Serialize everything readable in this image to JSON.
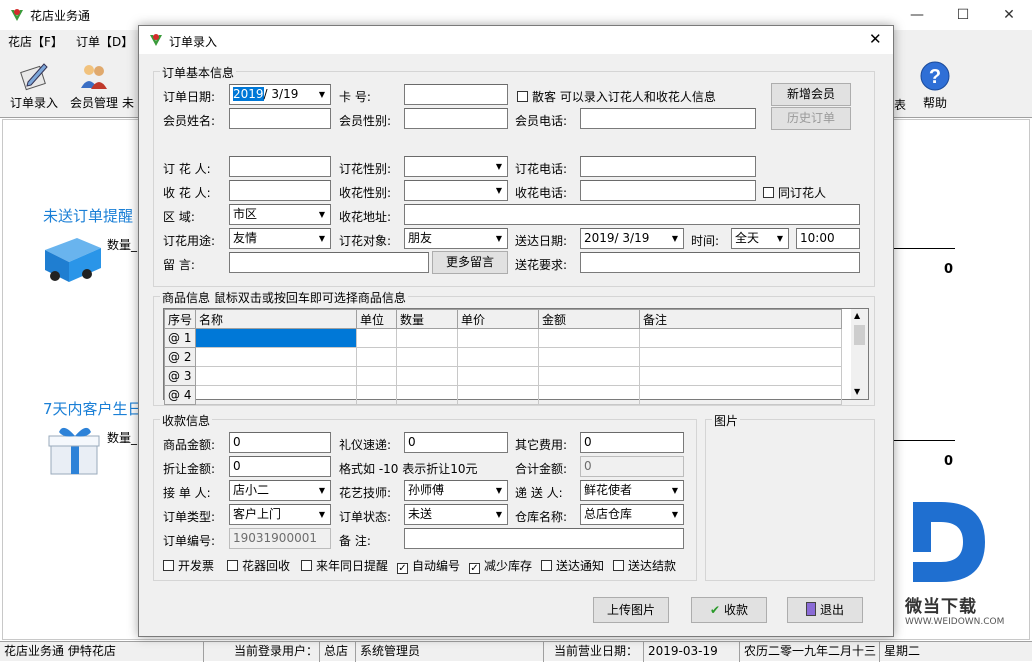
{
  "app": {
    "title": "花店业务通",
    "window_controls": {
      "minimize": "—",
      "maximize": "☐",
      "close": "✕"
    },
    "menu": [
      "花店【F】",
      "订单【D】"
    ],
    "toolbar": [
      {
        "label": "订单录入",
        "icon": "order-entry-icon"
      },
      {
        "label": "会员管理",
        "icon": "member-icon"
      },
      {
        "label": "未",
        "icon": "pending-icon"
      },
      {
        "label": "帮助",
        "icon": "help-icon"
      }
    ],
    "toolbar_partial_right": "表",
    "panels": [
      {
        "title": "未送订单提醒",
        "count_label": "数量_",
        "count_value": "0"
      },
      {
        "title": "7天内客户生日",
        "count_label": "数量_",
        "count_value": "0"
      }
    ],
    "watermark": {
      "brand": "微当下载",
      "url": "WWW.WEIDOWN.COM"
    },
    "status": {
      "app": "花店业务通 伊特花店",
      "user_label": "当前登录用户：",
      "store": "总店",
      "user": "系统管理员",
      "date_label": "当前营业日期：",
      "date": "2019-03-19",
      "lunar": "农历二零一九年二月十三",
      "weekday": "星期二"
    }
  },
  "dialog": {
    "title": "订单录入",
    "close": "✕",
    "basic": {
      "legend": "订单基本信息",
      "order_date_label": "订单日期:",
      "order_date_sel": "2019",
      "order_date_rest": "/ 3/19",
      "card_label": "卡      号:",
      "card_value": "",
      "walkin_label": "散客 可以录入订花人和收花人信息",
      "new_member": "新增会员",
      "history": "历史订单",
      "member_name_label": "会员姓名:",
      "member_gender_label": "会员性别:",
      "member_phone_label": "会员电话:",
      "orderer_label": "订 花 人:",
      "orderer_gender_label": "订花性别:",
      "orderer_phone_label": "订花电话:",
      "receiver_label": "收 花 人:",
      "receiver_gender_label": "收花性别:",
      "receiver_phone_label": "收花电话:",
      "same_as_orderer": "同订花人",
      "area_label": "区      域:",
      "area_value": "市区",
      "address_label": "收花地址:",
      "purpose_label": "订花用途:",
      "purpose_value": "友情",
      "target_label": "订花对象:",
      "target_value": "朋友",
      "deliver_date_label": "送达日期:",
      "deliver_date_value": "2019/  3/19",
      "time_label": "时间:",
      "time_value": "全天",
      "time_exact": "10:00",
      "message_label": "留      言:",
      "more_message": "更多留言",
      "delivery_req_label": "送花要求:"
    },
    "goods": {
      "legend": "商品信息 鼠标双击或按回车即可选择商品信息",
      "columns": [
        "序号",
        "名称",
        "单位",
        "数量",
        "单价",
        "金额",
        "备注"
      ],
      "rows": [
        "@ 1",
        "@ 2",
        "@ 3",
        "@ 4"
      ]
    },
    "payment": {
      "legend": "收款信息",
      "goods_amount_label": "商品金额:",
      "goods_amount": "0",
      "courier_label": "礼仪速递:",
      "courier": "0",
      "other_fee_label": "其它费用:",
      "other_fee": "0",
      "discount_label": "折让金额:",
      "discount": "0",
      "discount_hint": "格式如 -10 表示折让10元",
      "total_label": "合计金额:",
      "total": "0",
      "receiver_label": "接 单 人:",
      "receiver": "店小二",
      "florist_label": "花艺技师:",
      "florist": "孙师傅",
      "deliverer_label": "递 送 人:",
      "deliverer": "鲜花使者",
      "order_type_label": "订单类型:",
      "order_type": "客户上门",
      "order_status_label": "订单状态:",
      "order_status": "未送",
      "warehouse_label": "仓库名称:",
      "warehouse": "总店仓库",
      "order_no_label": "订单编号:",
      "order_no": "19031900001",
      "remark_label": "备      注:",
      "checkboxes": [
        {
          "label": "开发票",
          "checked": false
        },
        {
          "label": "花器回收",
          "checked": false
        },
        {
          "label": "来年同日提醒",
          "checked": false
        },
        {
          "label": "自动编号",
          "checked": true
        },
        {
          "label": "减少库存",
          "checked": true
        },
        {
          "label": "送达通知",
          "checked": false
        },
        {
          "label": "送达结款",
          "checked": false
        }
      ]
    },
    "picture": {
      "legend": "图片"
    },
    "buttons": {
      "upload": "上传图片",
      "collect": "收款",
      "exit": "退出"
    }
  }
}
